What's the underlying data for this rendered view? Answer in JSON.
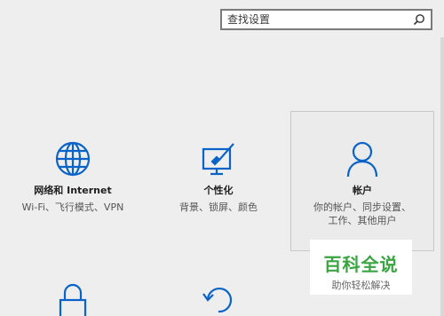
{
  "search": {
    "placeholder": "查找设置"
  },
  "tiles": [
    {
      "title": "网络和 Internet",
      "desc": "Wi-Fi、飞行模式、VPN",
      "icon": "globe-icon"
    },
    {
      "title": "个性化",
      "desc": "背景、锁屏、颜色",
      "icon": "personalization-icon"
    },
    {
      "title": "帐户",
      "desc_line1": "你的帐户、同步设置、",
      "desc_line2": "工作、其他用户",
      "icon": "user-icon"
    }
  ],
  "bottom_icons": [
    "lock-icon",
    "update-icon"
  ],
  "watermark": {
    "main": "百科全说",
    "sub": "助你轻松解决"
  },
  "colors": {
    "accent": "#0a63c9",
    "background": "#eeeeee"
  }
}
